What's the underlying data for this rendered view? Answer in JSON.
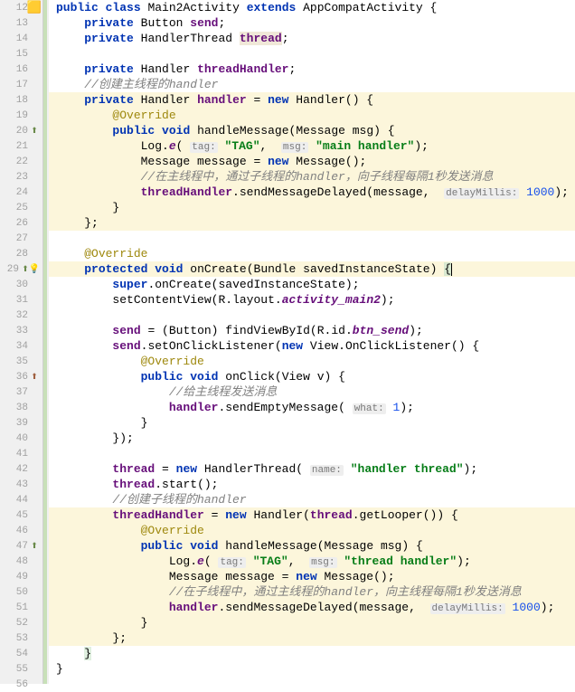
{
  "lines": {
    "l12": {
      "num": "12"
    },
    "l13": {
      "num": "13"
    },
    "l14": {
      "num": "14"
    },
    "l15": {
      "num": "15"
    },
    "l16": {
      "num": "16"
    },
    "l17": {
      "num": "17"
    },
    "l18": {
      "num": "18"
    },
    "l19": {
      "num": "19"
    },
    "l20": {
      "num": "20"
    },
    "l21": {
      "num": "21"
    },
    "l22": {
      "num": "22"
    },
    "l23": {
      "num": "23"
    },
    "l24": {
      "num": "24"
    },
    "l25": {
      "num": "25"
    },
    "l26": {
      "num": "26"
    },
    "l27": {
      "num": "27"
    },
    "l28": {
      "num": "28"
    },
    "l29": {
      "num": "29"
    },
    "l30": {
      "num": "30"
    },
    "l31": {
      "num": "31"
    },
    "l32": {
      "num": "32"
    },
    "l33": {
      "num": "33"
    },
    "l34": {
      "num": "34"
    },
    "l35": {
      "num": "35"
    },
    "l36": {
      "num": "36"
    },
    "l37": {
      "num": "37"
    },
    "l38": {
      "num": "38"
    },
    "l39": {
      "num": "39"
    },
    "l40": {
      "num": "40"
    },
    "l41": {
      "num": "41"
    },
    "l42": {
      "num": "42"
    },
    "l43": {
      "num": "43"
    },
    "l44": {
      "num": "44"
    },
    "l45": {
      "num": "45"
    },
    "l46": {
      "num": "46"
    },
    "l47": {
      "num": "47"
    },
    "l48": {
      "num": "48"
    },
    "l49": {
      "num": "49"
    },
    "l50": {
      "num": "50"
    },
    "l51": {
      "num": "51"
    },
    "l52": {
      "num": "52"
    },
    "l53": {
      "num": "53"
    },
    "l54": {
      "num": "54"
    },
    "l55": {
      "num": "55"
    },
    "l56": {
      "num": "56"
    }
  },
  "code": {
    "public": "public",
    "class": "class",
    "private": "private",
    "extends": "extends",
    "void": "void",
    "new": "new",
    "super": "super",
    "protected": "protected",
    "Main2Activity": "Main2Activity",
    "AppCompatActivity": "AppCompatActivity",
    "Button": "Button",
    "send": "send",
    "HandlerThread": "HandlerThread",
    "thread": "thread",
    "Handler": "Handler",
    "threadHandler": "threadHandler",
    "handler": "handler",
    "Override": "@Override",
    "handleMessage": "handleMessage",
    "Message": "Message",
    "msg": "msg",
    "Log": "Log",
    "e": "e",
    "tag_hint": "tag:",
    "msg_hint": "msg:",
    "delay_hint": "delayMillis:",
    "what_hint": "what:",
    "name_hint": "name:",
    "TAG": "\"TAG\"",
    "main_handler": "\"main handler\"",
    "thread_handler": "\"thread handler\"",
    "handler_thread": "\"handler thread\"",
    "message": "message",
    "comment_main_handler": "//创建主线程的handler",
    "comment_sub_handler": "//创建子线程的handler",
    "comment_main_thread": "//在主线程中，通过子线程的handler，向子线程每隔1秒发送消息",
    "comment_sub_thread": "//在子线程中，通过主线程的handler，向主线程每隔1秒发送消息",
    "comment_send_msg": "//给主线程发送消息",
    "sendMessageDelayed": "sendMessageDelayed",
    "sendEmptyMessage": "sendEmptyMessage",
    "thousand": "1000",
    "one": "1",
    "onCreate": "onCreate",
    "Bundle": "Bundle",
    "savedInstanceState": "savedInstanceState",
    "setContentView": "setContentView",
    "R": "R",
    "layout": "layout",
    "activity_main2": "activity_main2",
    "findViewById": "findViewById",
    "id": "id",
    "btn_send": "btn_send",
    "setOnClickListener": "setOnClickListener",
    "View": "View",
    "OnClickListener": "OnClickListener",
    "onClick": "onClick",
    "v": "v",
    "start": "start",
    "getLooper": "getLooper"
  }
}
